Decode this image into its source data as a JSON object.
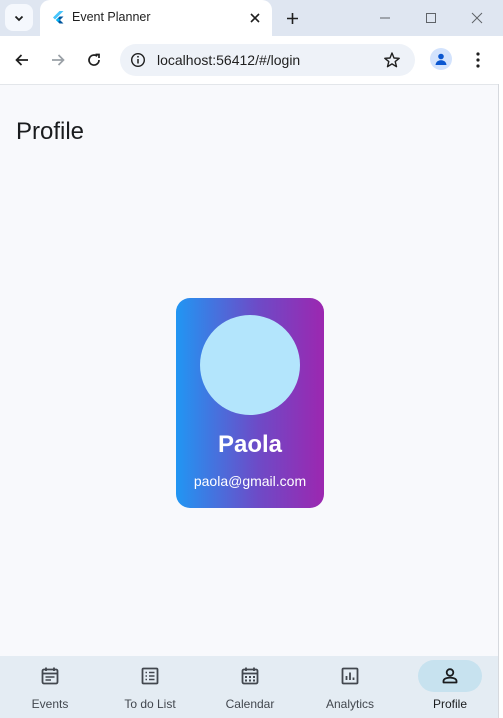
{
  "browser": {
    "tab_title": "Event Planner",
    "url": "localhost:56412/#/login"
  },
  "page": {
    "title": "Profile"
  },
  "profile": {
    "name": "Paola",
    "email": "paola@gmail.com"
  },
  "bottom_nav": {
    "items": [
      {
        "label": "Events",
        "icon": "event-note-icon"
      },
      {
        "label": "To do List",
        "icon": "list-icon"
      },
      {
        "label": "Calendar",
        "icon": "calendar-icon"
      },
      {
        "label": "Analytics",
        "icon": "analytics-icon"
      },
      {
        "label": "Profile",
        "icon": "person-icon",
        "active": true
      }
    ]
  },
  "colors": {
    "card_gradient_start": "#2196f3",
    "card_gradient_end": "#9c27b0",
    "avatar": "#b3e5fc",
    "active_nav_pill": "#c7e2ef"
  }
}
